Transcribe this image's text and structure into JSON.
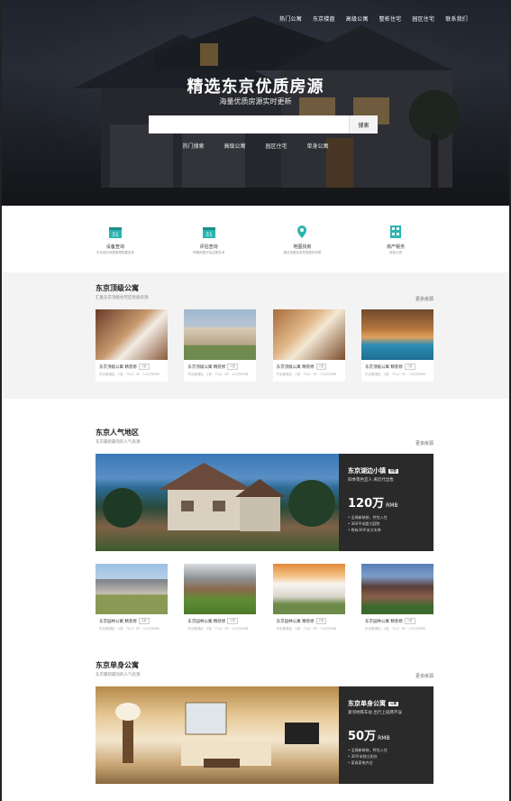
{
  "nav": [
    "热门公寓",
    "东京楼盘",
    "高级公寓",
    "整栋住宅",
    "园区住宅",
    "联系我们"
  ],
  "hero": {
    "title": "精选东京优质房源",
    "subtitle": "海量优质房源实时更新",
    "search_placeholder": "",
    "search_button": "搜索",
    "hot_links": [
      "热门搜索",
      "高级公寓",
      "园区住宅",
      "单身公寓"
    ]
  },
  "services": [
    {
      "icon": "calendar-icon",
      "title": "设备查询",
      "desc": "东京地区房屋管理配置查询"
    },
    {
      "icon": "calendar-icon",
      "title": "评估查询",
      "desc": "精确房屋评估结果查询"
    },
    {
      "icon": "map-pin-icon",
      "title": "地图找房",
      "desc": "通过地图找到您想要的房屋"
    },
    {
      "icon": "calculator-icon",
      "title": "房产税务",
      "desc": "税费计算"
    }
  ],
  "section1": {
    "title": "东京顶级公寓",
    "desc": "汇集东京顶级住宅区优质房源",
    "more": "更多房源",
    "cards": [
      {
        "name": "东京顶级公寓 精装修",
        "tag": "2室",
        "meta": "东京都港区 · 2室 · 75㎡ · 6F · 120万RMB"
      },
      {
        "name": "东京顶级公寓 精装修",
        "tag": "2室",
        "meta": "东京都港区 · 2室 · 75㎡ · 6F · 120万RMB"
      },
      {
        "name": "东京顶级公寓 精装修",
        "tag": "2室",
        "meta": "东京都港区 · 2室 · 75㎡ · 6F · 120万RMB"
      },
      {
        "name": "东京顶级公寓 精装修",
        "tag": "2室",
        "meta": "东京都港区 · 2室 · 75㎡ · 6F · 120万RMB"
      }
    ]
  },
  "section2": {
    "title": "东京人气地区",
    "desc": "东京最新最热的人气房源",
    "more": "更多房源",
    "feature": {
      "title": "东京湖边小镇",
      "badge": "别墅",
      "subtitle": "四季景色宜人 离近代出售",
      "price": "120万",
      "unit": "RMB",
      "points": [
        "全周新装修，拎包入住",
        "300平米超大庭院",
        "附有30平米大车库"
      ]
    },
    "cards": [
      {
        "name": "东京园林公寓 精装修",
        "tag": "2室",
        "meta": "东京都港区 · 2室 · 75㎡ · 6F · 120万RMB"
      },
      {
        "name": "东京园林公寓 精装修",
        "tag": "2室",
        "meta": "东京都港区 · 2室 · 75㎡ · 6F · 120万RMB"
      },
      {
        "name": "东京园林公寓 精装修",
        "tag": "2室",
        "meta": "东京都港区 · 2室 · 75㎡ · 6F · 120万RMB"
      },
      {
        "name": "东京园林公寓 精装修",
        "tag": "2室",
        "meta": "东京都港区 · 2室 · 75㎡ · 6F · 120万RMB"
      }
    ]
  },
  "section3": {
    "title": "东京单身公寓",
    "desc": "东京最新最热的人气房源",
    "more": "更多房源",
    "feature": {
      "title": "东京单身公寓",
      "badge": "公寓",
      "subtitle": "紧邻地铁车站 出行上班两不误",
      "price": "50万",
      "unit": "RMB",
      "points": [
        "全周新装修，拎包入住",
        "30平米独立阳台",
        "家具家电齐全"
      ]
    }
  }
}
